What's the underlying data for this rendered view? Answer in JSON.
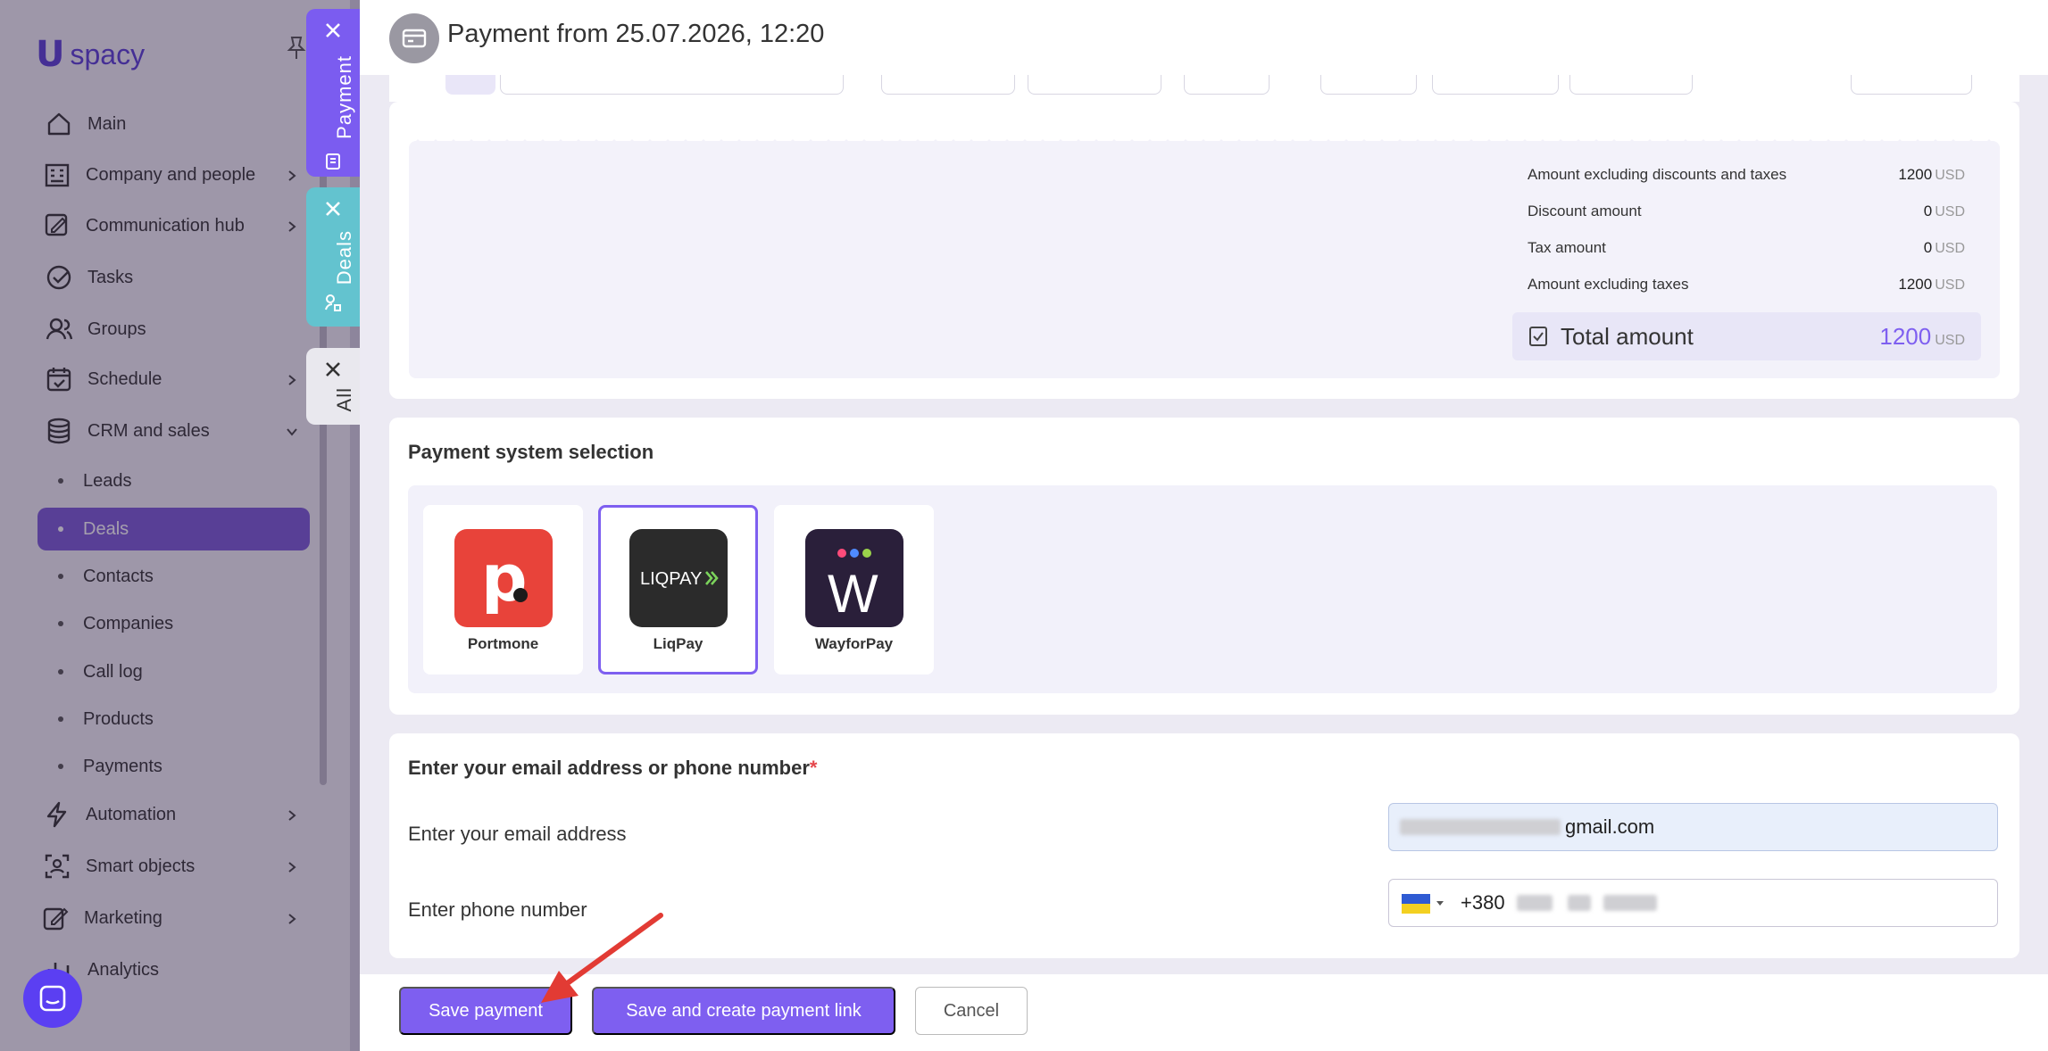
{
  "app": {
    "brand": "spacy",
    "brand_mark": "U"
  },
  "sidebar": {
    "items": [
      {
        "label": "Main",
        "icon": "home-icon"
      },
      {
        "label": "Company and people",
        "icon": "building-icon"
      },
      {
        "label": "Communication hub",
        "icon": "chat-edit-icon"
      },
      {
        "label": "Tasks",
        "icon": "check-circle-icon"
      },
      {
        "label": "Groups",
        "icon": "users-icon"
      },
      {
        "label": "Schedule",
        "icon": "calendar-icon"
      },
      {
        "label": "CRM and sales",
        "icon": "database-icon"
      },
      {
        "label": "Automation",
        "icon": "lightning-icon"
      },
      {
        "label": "Smart objects",
        "icon": "scan-icon"
      },
      {
        "label": "Marketing",
        "icon": "edit-box-icon"
      },
      {
        "label": "Analytics",
        "icon": "chart-icon"
      }
    ],
    "crm_sub": [
      "Leads",
      "Deals",
      "Contacts",
      "Companies",
      "Call log",
      "Products",
      "Payments"
    ],
    "active_sub": "Deals"
  },
  "tabs": [
    {
      "label": "Payment",
      "color": "#7b5cf0"
    },
    {
      "label": "Deals",
      "color": "#63c3cf"
    },
    {
      "label": "All",
      "color": "#e9e8ee"
    }
  ],
  "header": {
    "title": "Payment from 25.07.2026, 12:20"
  },
  "summary": {
    "rows": [
      {
        "label": "Amount excluding discounts and taxes",
        "value": "1200",
        "currency": "USD"
      },
      {
        "label": "Discount amount",
        "value": "0",
        "currency": "USD"
      },
      {
        "label": "Tax amount",
        "value": "0",
        "currency": "USD"
      },
      {
        "label": "Amount excluding taxes",
        "value": "1200",
        "currency": "USD"
      }
    ],
    "total": {
      "label": "Total amount",
      "value": "1200",
      "currency": "USD"
    }
  },
  "payment_system": {
    "title": "Payment system selection",
    "options": [
      {
        "name": "Portmone",
        "logo_text": "p.",
        "color": "#e8433a",
        "selected": false
      },
      {
        "name": "LiqPay",
        "logo_text": "LIQPAY",
        "color": "#2b2b2b",
        "selected": true
      },
      {
        "name": "WayforPay",
        "logo_text": "W",
        "color": "#2a1f3a",
        "selected": false
      }
    ]
  },
  "contact": {
    "title": "Enter your email address or phone number",
    "required_mark": "*",
    "email_label": "Enter your email address",
    "email_value": "gmail.com",
    "phone_label": "Enter phone number",
    "phone_prefix": "+380"
  },
  "footer": {
    "save": "Save payment",
    "save_link": "Save and create payment link",
    "cancel": "Cancel"
  },
  "colors": {
    "accent": "#7e5ff0"
  }
}
